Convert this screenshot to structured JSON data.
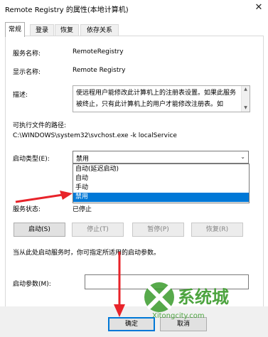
{
  "window": {
    "title": "Remote Registry 的属性(本地计算机)",
    "close_glyph": "✕"
  },
  "tabs": [
    {
      "label": "常规",
      "active": true
    },
    {
      "label": "登录",
      "active": false
    },
    {
      "label": "恢复",
      "active": false
    },
    {
      "label": "依存关系",
      "active": false
    }
  ],
  "general": {
    "service_name_label": "服务名称:",
    "service_name": "RemoteRegistry",
    "display_name_label": "显示名称:",
    "display_name": "Remote Registry",
    "description_label": "描述:",
    "description": "使远程用户能修改此计算机上的注册表设置。如果此服务被终止，只有此计算机上的用户才能修改注册表。如",
    "exe_path_label": "可执行文件的路径:",
    "exe_path": "C:\\WINDOWS\\system32\\svchost.exe -k localService",
    "startup_type_label": "启动类型(E):",
    "startup_type_value": "禁用",
    "startup_options": [
      "自动(延迟启动)",
      "自动",
      "手动",
      "禁用"
    ],
    "startup_selected_index": 3,
    "service_status_label": "服务状态:",
    "service_status": "已停止",
    "buttons": {
      "start": "启动(S)",
      "stop": "停止(T)",
      "pause": "暂停(P)",
      "resume": "恢复(R)"
    },
    "hint": "当从此处启动服务时，你可指定所适用的启动参数。",
    "start_params_label": "启动参数(M):",
    "start_params_value": ""
  },
  "dialog_buttons": {
    "ok": "确定",
    "cancel": "取消"
  },
  "watermark": {
    "brand": "系统城",
    "url": "Xitongcity.com"
  },
  "colors": {
    "accent": "#0078d7",
    "annotation_arrow": "#e8232a",
    "watermark": "#3a9b2b"
  }
}
